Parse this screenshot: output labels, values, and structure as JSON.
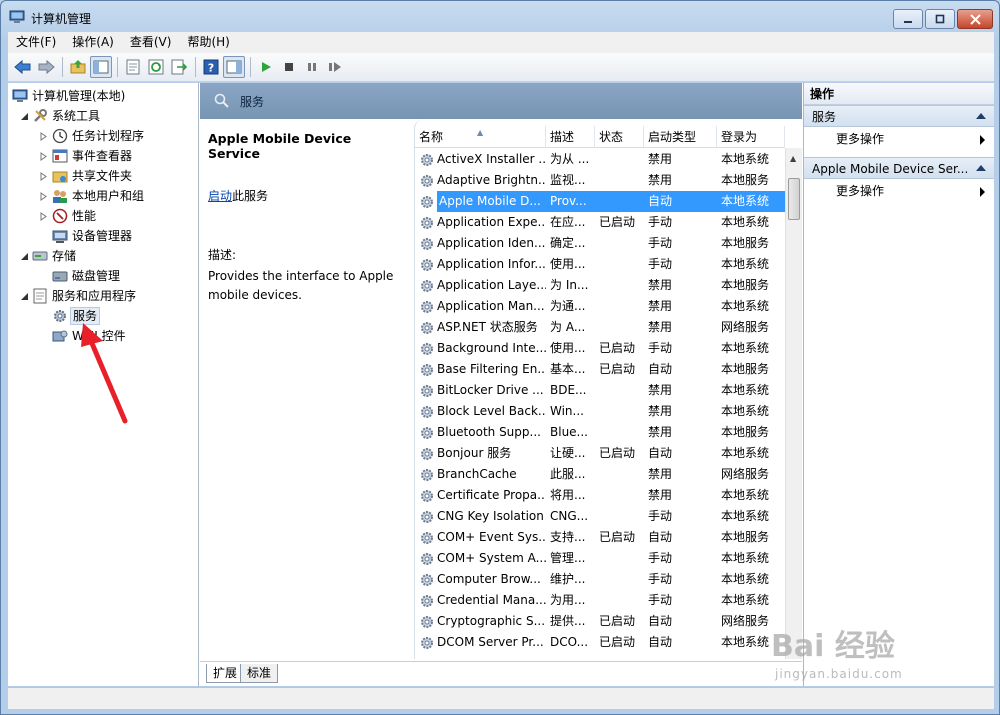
{
  "window": {
    "title": "计算机管理"
  },
  "menu": [
    {
      "label": "文件(F)"
    },
    {
      "label": "操作(A)"
    },
    {
      "label": "查看(V)"
    },
    {
      "label": "帮助(H)"
    }
  ],
  "tree": {
    "items": [
      {
        "label": "计算机管理(本地)",
        "icon": "computer-icon"
      },
      {
        "label": "系统工具",
        "icon": "tools-icon"
      },
      {
        "label": "任务计划程序",
        "icon": "clock-icon"
      },
      {
        "label": "事件查看器",
        "icon": "event-viewer-icon"
      },
      {
        "label": "共享文件夹",
        "icon": "shared-folder-icon"
      },
      {
        "label": "本地用户和组",
        "icon": "users-icon"
      },
      {
        "label": "性能",
        "icon": "performance-icon"
      },
      {
        "label": "设备管理器",
        "icon": "device-manager-icon"
      },
      {
        "label": "存储",
        "icon": "storage-icon"
      },
      {
        "label": "磁盘管理",
        "icon": "disk-icon"
      },
      {
        "label": "服务和应用程序",
        "icon": "services-apps-icon"
      },
      {
        "label": "服务",
        "icon": "gear-icon"
      },
      {
        "label": "WMI 控件",
        "icon": "wmi-icon"
      }
    ]
  },
  "center": {
    "header_title": "服务",
    "detail": {
      "service_name": "Apple Mobile Device Service",
      "start_link": "启动",
      "start_suffix": "此服务",
      "desc_label": "描述:",
      "desc_text": "Provides the interface to Apple mobile devices."
    },
    "columns": [
      "名称",
      "描述",
      "状态",
      "启动类型",
      "登录为"
    ],
    "rows": [
      {
        "name": "ActiveX Installer ...",
        "desc": "为从 ...",
        "status": "",
        "start": "禁用",
        "logon": "本地系统"
      },
      {
        "name": "Adaptive Brightn...",
        "desc": "监视...",
        "status": "",
        "start": "禁用",
        "logon": "本地服务"
      },
      {
        "name": "Apple Mobile D...",
        "desc": "Prov...",
        "status": "",
        "start": "自动",
        "logon": "本地系统"
      },
      {
        "name": "Application Expe...",
        "desc": "在应...",
        "status": "已启动",
        "start": "手动",
        "logon": "本地系统"
      },
      {
        "name": "Application Iden...",
        "desc": "确定...",
        "status": "",
        "start": "手动",
        "logon": "本地服务"
      },
      {
        "name": "Application Infor...",
        "desc": "使用...",
        "status": "",
        "start": "手动",
        "logon": "本地系统"
      },
      {
        "name": "Application Laye...",
        "desc": "为 In...",
        "status": "",
        "start": "禁用",
        "logon": "本地服务"
      },
      {
        "name": "Application Man...",
        "desc": "为通...",
        "status": "",
        "start": "禁用",
        "logon": "本地系统"
      },
      {
        "name": "ASP.NET 状态服务",
        "desc": "为 A...",
        "status": "",
        "start": "禁用",
        "logon": "网络服务"
      },
      {
        "name": "Background Inte...",
        "desc": "使用...",
        "status": "已启动",
        "start": "手动",
        "logon": "本地系统"
      },
      {
        "name": "Base Filtering En...",
        "desc": "基本...",
        "status": "已启动",
        "start": "自动",
        "logon": "本地服务"
      },
      {
        "name": "BitLocker Drive ...",
        "desc": "BDE...",
        "status": "",
        "start": "禁用",
        "logon": "本地系统"
      },
      {
        "name": "Block Level Back...",
        "desc": "Win...",
        "status": "",
        "start": "禁用",
        "logon": "本地系统"
      },
      {
        "name": "Bluetooth Supp...",
        "desc": "Blue...",
        "status": "",
        "start": "禁用",
        "logon": "本地服务"
      },
      {
        "name": "Bonjour 服务",
        "desc": "让硬...",
        "status": "已启动",
        "start": "自动",
        "logon": "本地系统"
      },
      {
        "name": "BranchCache",
        "desc": "此服...",
        "status": "",
        "start": "禁用",
        "logon": "网络服务"
      },
      {
        "name": "Certificate Propa...",
        "desc": "将用...",
        "status": "",
        "start": "禁用",
        "logon": "本地系统"
      },
      {
        "name": "CNG Key Isolation",
        "desc": "CNG...",
        "status": "",
        "start": "手动",
        "logon": "本地系统"
      },
      {
        "name": "COM+ Event Sys...",
        "desc": "支持...",
        "status": "已启动",
        "start": "自动",
        "logon": "本地服务"
      },
      {
        "name": "COM+ System A...",
        "desc": "管理...",
        "status": "",
        "start": "手动",
        "logon": "本地系统"
      },
      {
        "name": "Computer Brow...",
        "desc": "维护...",
        "status": "",
        "start": "手动",
        "logon": "本地系统"
      },
      {
        "name": "Credential Mana...",
        "desc": "为用...",
        "status": "",
        "start": "手动",
        "logon": "本地系统"
      },
      {
        "name": "Cryptographic S...",
        "desc": "提供...",
        "status": "已启动",
        "start": "自动",
        "logon": "网络服务"
      },
      {
        "name": "DCOM Server Pr...",
        "desc": "DCO...",
        "status": "已启动",
        "start": "自动",
        "logon": "本地系统"
      }
    ],
    "tabs": [
      "扩展",
      "标准"
    ]
  },
  "actions": {
    "title": "操作",
    "sections": [
      {
        "label": "服务",
        "item": "更多操作"
      },
      {
        "label": "Apple Mobile Device Ser...",
        "item": "更多操作"
      }
    ]
  },
  "watermark": {
    "brand": "Bai 经验",
    "url": "jingyan.baidu.com"
  },
  "colors": {
    "selection": "#3399ff",
    "header": "#7f9cbb",
    "annotation_arrow": "#e8202a"
  }
}
